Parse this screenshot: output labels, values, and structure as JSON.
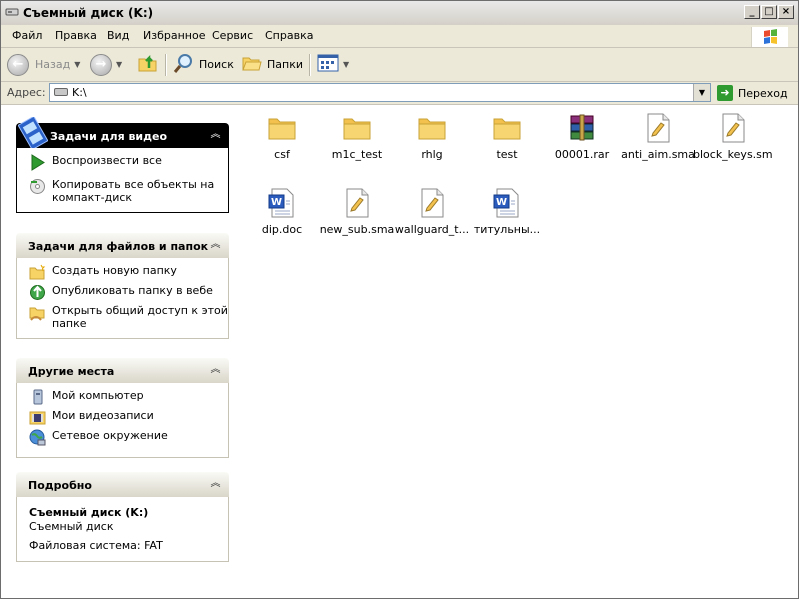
{
  "window": {
    "title": "Съемный диск (K:)"
  },
  "menu": [
    "Файл",
    "Правка",
    "Вид",
    "Избранное",
    "Сервис",
    "Справка"
  ],
  "toolbar": {
    "back": "Назад",
    "search": "Поиск",
    "folders": "Папки"
  },
  "address": {
    "label": "Адрес:",
    "value": "K:\\",
    "go": "Переход"
  },
  "panels": {
    "video": {
      "title": "Задачи для видео",
      "tasks": [
        "Воспроизвести все",
        "Копировать все объекты на компакт-диск"
      ]
    },
    "files": {
      "title": "Задачи для файлов и папок",
      "tasks": [
        "Создать новую папку",
        "Опубликовать папку в вебе",
        "Открыть общий доступ к этой папке"
      ]
    },
    "places": {
      "title": "Другие места",
      "tasks": [
        "Мой компьютер",
        "Мои видеозаписи",
        "Сетевое окружение"
      ]
    },
    "details": {
      "title": "Подробно",
      "name": "Съемный диск (K:)",
      "type": "Съемный диск",
      "fs": "Файловая система: FAT"
    }
  },
  "files": [
    {
      "name": "csf",
      "kind": "folder"
    },
    {
      "name": "m1c_test",
      "kind": "folder"
    },
    {
      "name": "rhlg",
      "kind": "folder"
    },
    {
      "name": "test",
      "kind": "folder"
    },
    {
      "name": "00001.rar",
      "kind": "rar"
    },
    {
      "name": "anti_aim.sma",
      "kind": "sma"
    },
    {
      "name": "block_keys.sma",
      "kind": "sma"
    },
    {
      "name": "dip.doc",
      "kind": "doc"
    },
    {
      "name": "new_sub.sma",
      "kind": "sma"
    },
    {
      "name": "wallguard_t...",
      "kind": "sma"
    },
    {
      "name": "титульны...",
      "kind": "doc"
    }
  ],
  "colors": {
    "folder": "#f7d264",
    "doc": "#2b5bbd",
    "go": "#2f9a2f"
  }
}
